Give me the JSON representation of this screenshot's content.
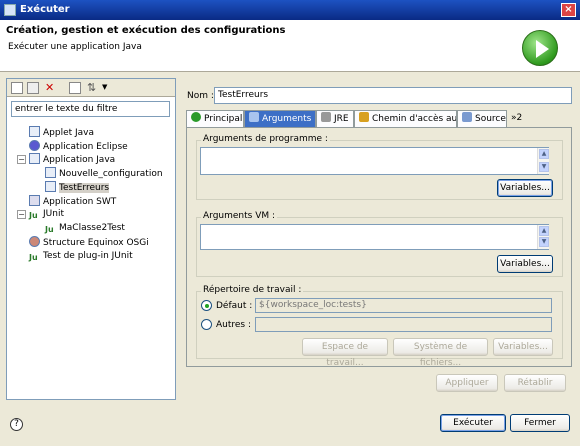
{
  "window": {
    "title": "Exécuter"
  },
  "header": {
    "title": "Création, gestion et exécution des configurations",
    "subtitle": "Exécuter une application Java"
  },
  "left": {
    "filter_placeholder": "entrer le texte du filtre",
    "tree": [
      {
        "label": "Applet Java"
      },
      {
        "label": "Application Eclipse"
      },
      {
        "label": "Application Java"
      },
      {
        "label": "Nouvelle_configuration"
      },
      {
        "label": "TestErreurs"
      },
      {
        "label": "Application SWT"
      },
      {
        "label": "JUnit"
      },
      {
        "label": "MaClasse2Test"
      },
      {
        "label": "Structure Equinox OSGi"
      },
      {
        "label": "Test de plug-in JUnit"
      }
    ]
  },
  "name": {
    "label": "Nom :",
    "value": "TestErreurs"
  },
  "tabs": [
    "Principal",
    "Arguments",
    "JRE",
    "Chemin d'accès au...",
    "Source",
    "»2"
  ],
  "program_args": {
    "title": "Arguments de programme :",
    "variables": "Variables..."
  },
  "vm_args": {
    "title": "Arguments VM :",
    "variables": "Variables..."
  },
  "workdir": {
    "title": "Répertoire de travail :",
    "default_label": "Défaut :",
    "default_value": "${workspace_loc:tests}",
    "others_label": "Autres :",
    "workspace_btn": "Espace de travail...",
    "filesystem_btn": "Système de fichiers...",
    "variables_btn": "Variables..."
  },
  "actions": {
    "apply": "Appliquer",
    "revert": "Rétablir",
    "run": "Exécuter",
    "close": "Fermer"
  },
  "help": "?"
}
